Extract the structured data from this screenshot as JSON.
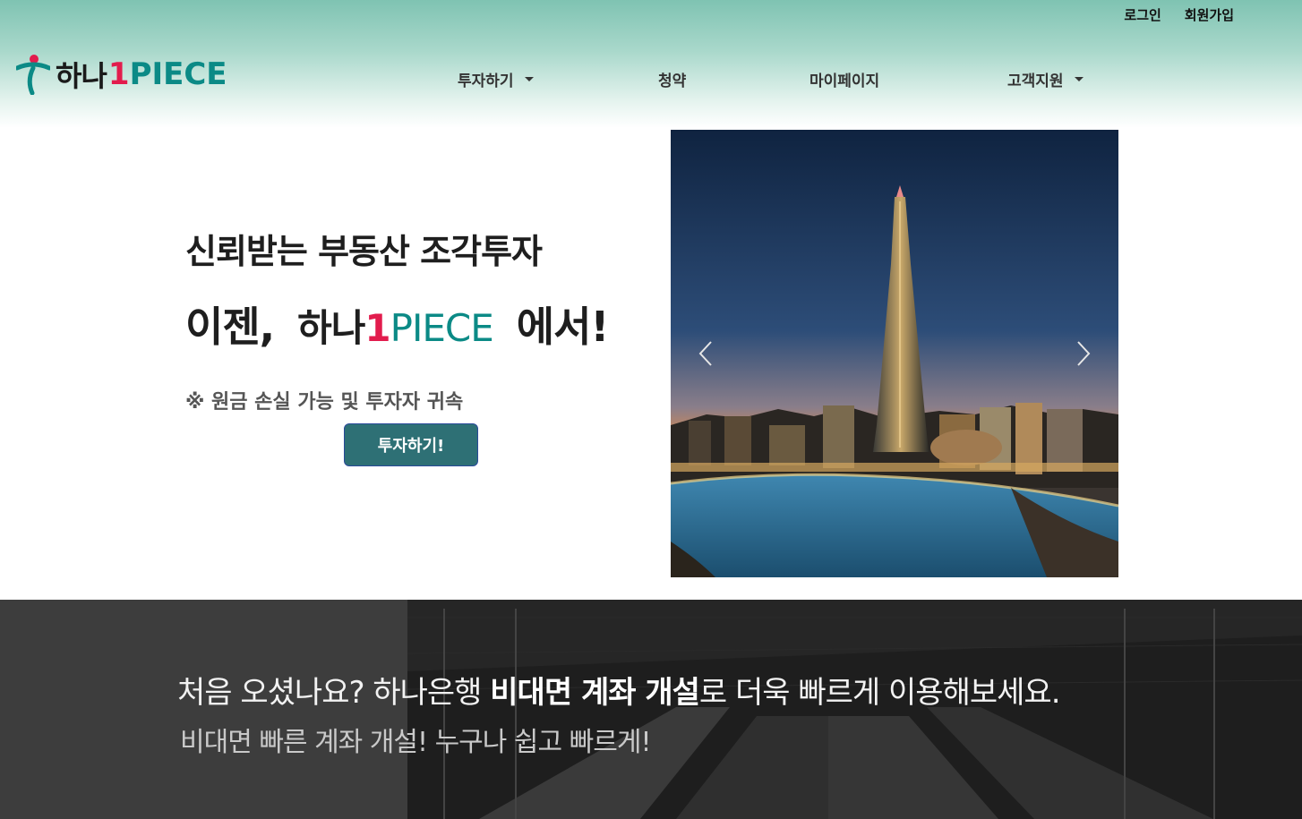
{
  "header": {
    "top_links": {
      "login": "로그인",
      "signup": "회원가입"
    },
    "logo": {
      "hana": "하나",
      "one": "1",
      "piece": "PIECE"
    },
    "nav": {
      "invest": "투자하기",
      "subscription": "청약",
      "mypage": "마이페이지",
      "support": "고객지원"
    }
  },
  "hero": {
    "headline1": "신뢰받는 부동산 조각투자",
    "headline2_prefix": "이젠,",
    "headline2_brand_hana": "하나",
    "headline2_brand_one": "1",
    "headline2_brand_piece": "PIECE",
    "headline2_suffix": "에서!",
    "warning": "※ 원금 손실 가능 및 투자자 귀속",
    "invest_button": "투자하기!"
  },
  "carousel": {
    "prev_icon": "chevron-left-icon",
    "next_icon": "chevron-right-icon"
  },
  "banner": {
    "title_prefix": "처음 오셨나요? 하나은행 ",
    "title_bold": "비대면 계좌 개설",
    "title_suffix": "로 더욱 빠르게 이용해보세요.",
    "subtitle": "비대면 빠른 계좌 개설! 누구나 쉽고 빠르게!"
  },
  "colors": {
    "brand_red": "#e21c4d",
    "brand_teal": "#0b8a86",
    "button": "#2e7075",
    "header_top": "#7fc3b2"
  }
}
